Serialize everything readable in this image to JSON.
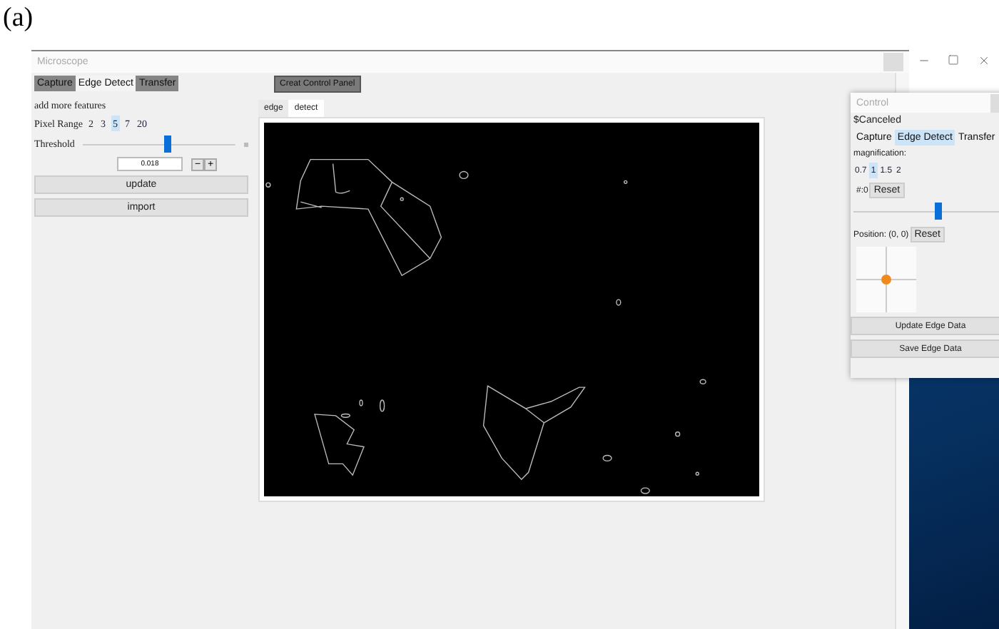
{
  "caption": "(a)",
  "main_window": {
    "title": "Microscope",
    "tabs": [
      {
        "label": "Capture",
        "selected": false
      },
      {
        "label": "Edge Detect",
        "selected": true
      },
      {
        "label": "Transfer",
        "selected": false
      }
    ],
    "features_label": "add more features",
    "pixel_range": {
      "label": "Pixel Range",
      "options": [
        {
          "label": "2",
          "selected": false
        },
        {
          "label": "3",
          "selected": false
        },
        {
          "label": "5",
          "selected": true
        },
        {
          "label": "7",
          "selected": false
        },
        {
          "label": "20",
          "selected": false
        }
      ]
    },
    "threshold": {
      "label": "Threshold",
      "level": 0.55,
      "value": "0.018",
      "decrement": "−",
      "increment": "+"
    },
    "buttons": [
      "update",
      "import"
    ],
    "create_button": "Creat Control Panel",
    "view_tabs": [
      {
        "label": "edge",
        "selected": false
      },
      {
        "label": "detect",
        "selected": true
      }
    ]
  },
  "control_window": {
    "title": "Control",
    "status": "$Canceled",
    "tabs": [
      {
        "label": "Capture",
        "selected": false
      },
      {
        "label": "Edge Detect",
        "selected": true
      },
      {
        "label": "Transfer",
        "selected": false
      }
    ],
    "magnification_label": "magnification:",
    "magnification": [
      {
        "label": "0.7",
        "selected": false
      },
      {
        "label": "1",
        "selected": true
      },
      {
        "label": "1.5",
        "selected": false
      },
      {
        "label": "2",
        "selected": false
      }
    ],
    "counter": "#:0",
    "counter_reset": "Reset",
    "slider": {
      "level": 0.55
    },
    "position": "Position: (0, 0)",
    "position_reset": "Reset",
    "buttons": [
      "Update Edge Data",
      "Save Edge Data"
    ]
  }
}
